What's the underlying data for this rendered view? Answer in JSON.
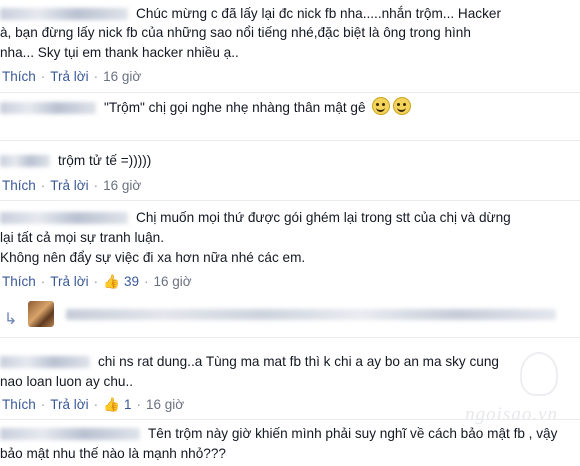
{
  "comments": [
    {
      "lines": [
        "Chúc mừng c đã lấy lại đc nick fb nha.....nhắn trộm... Hacker",
        "à, bạn đừng lấy nick fb của những sao nổi tiếng nhé,đặc biệt là ông trong hình",
        "nha... Sky tụi em thank hacker nhiều ạ.."
      ],
      "like": "Thích",
      "reply": "Trả lời",
      "time": "16 giờ"
    },
    {
      "lines": [
        "\"Trộm\" chị gọi nghe nhẹ nhàng thân mật gê"
      ],
      "emoji": "laughing-emoji"
    },
    {
      "lines": [
        "trộm tử tế =)))))"
      ],
      "like": "Thích",
      "reply": "Trả lời",
      "time": "16 giờ"
    },
    {
      "lines": [
        "Chị muốn mọi thứ được gói ghém lại trong stt của chị và dừng",
        "lại tất cả mọi sự tranh luận.",
        "Không nên đẩy sự việc đi xa hơn nữa nhé các em."
      ],
      "like": "Thích",
      "reply": "Trả lời",
      "like_count": "39",
      "time": "16 giờ"
    },
    {
      "lines": [
        "chi ns rat dung..a Tùng ma mat fb thì k chi a ay bo an ma sky cung",
        "nao loan luon ay chu.."
      ],
      "like": "Thích",
      "reply": "Trả lời",
      "like_count": "1",
      "time": "16 giờ"
    },
    {
      "lines": [
        "Tên trộm này giờ khiến mình phải suy nghĩ về cách bảo mật fb , vậy",
        "bảo mật nhu thế nào là mạnh nhỏ???"
      ]
    }
  ],
  "watermark": "ngoisao.vn",
  "colors": {
    "link": "#3b5998",
    "meta": "#6a7180",
    "text": "#141823"
  },
  "icons": {
    "like": "thumbs-up-icon",
    "reply": "reply-arrow-icon"
  }
}
